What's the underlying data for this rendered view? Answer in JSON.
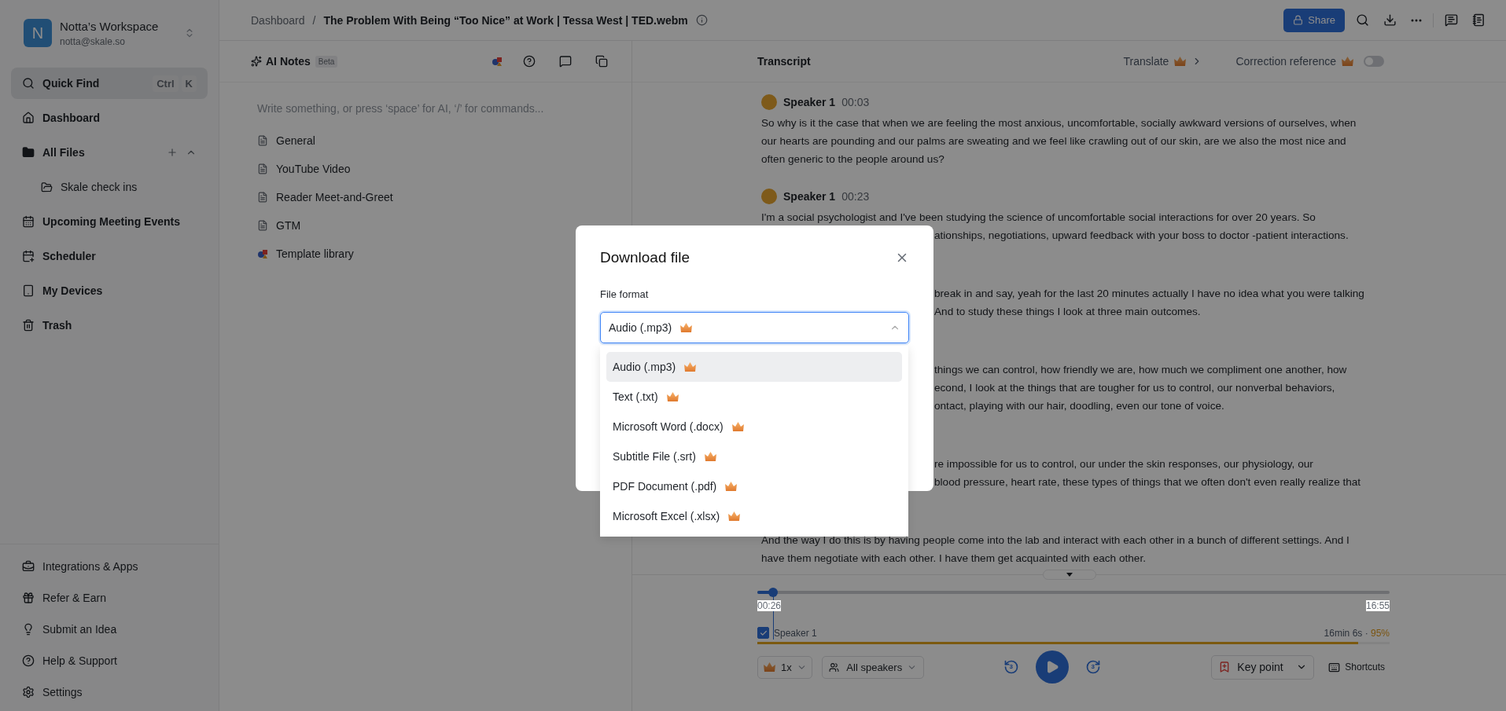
{
  "workspace": {
    "initial": "N",
    "name": "Notta’s Workspace",
    "email": "notta@skale.so"
  },
  "sidebar": {
    "quick_find": {
      "label": "Quick Find",
      "keys": [
        "Ctrl",
        "K"
      ],
      "selected": true
    },
    "items": [
      {
        "label": "Dashboard",
        "selected": false
      },
      {
        "label": "All Files",
        "selected": false,
        "expanded": true,
        "children": [
          {
            "label": "Skale check ins",
            "selected": false
          }
        ]
      },
      {
        "label": "Upcoming Meeting Events",
        "selected": false
      },
      {
        "label": "Scheduler",
        "selected": false
      },
      {
        "label": "My Devices",
        "selected": false
      },
      {
        "label": "Trash",
        "selected": false
      }
    ],
    "bottom_items": [
      {
        "label": "Integrations & Apps"
      },
      {
        "label": "Refer & Earn"
      },
      {
        "label": "Submit an Idea"
      },
      {
        "label": "Help & Support"
      },
      {
        "label": "Settings"
      }
    ]
  },
  "breadcrumb": {
    "parent": "Dashboard",
    "separator": "/",
    "title": "The Problem With Being “Too Nice” at Work | Tessa West | TED.webm"
  },
  "share_button": "Share",
  "notes": {
    "title": "AI Notes",
    "badge": "Beta",
    "placeholder": "Write something, or press ‘space’ for AI, ‘/’ for commands...",
    "templates": [
      {
        "label": "General",
        "kind": "doc"
      },
      {
        "label": "YouTube Video",
        "kind": "doc"
      },
      {
        "label": "Reader Meet-and-Greet",
        "kind": "doc"
      },
      {
        "label": "GTM",
        "kind": "doc"
      },
      {
        "label": "Template library",
        "kind": "library"
      }
    ]
  },
  "transcript": {
    "title": "Transcript",
    "translate": "Translate",
    "correction": {
      "label": "Correction reference",
      "on": false
    },
    "segments": [
      {
        "speaker": "Speaker 1",
        "time": "00:03",
        "lines": [
          {
            "kind": "full",
            "text": "So why is it the case that when we are feeling the most anxious, uncomfortable, socially awkward versions of ourselves, when"
          },
          {
            "kind": "full",
            "text": "our hearts are pounding and our palms are sweating and we feel like crawling out of our skin, are we also the most nice and"
          },
          {
            "kind": "full",
            "text": "often generic to the people around us?"
          }
        ]
      },
      {
        "speaker": "Speaker 1",
        "time": "00:23",
        "lines": [
          {
            "kind": "full",
            "text": "I'm a social psychologist and I've been studying the science of uncomfortable social interactions for over 20 years. So"
          },
          {
            "kind": "clipped",
            "text": "ationships, negotiations, upward feedback with your boss to doctor -patient interactions."
          }
        ]
      },
      {
        "lines": [
          {
            "kind": "clipped",
            "text": "break in and say, yeah for the last 20 minutes actually I have no idea what you were talking"
          },
          {
            "kind": "clipped",
            "text": "And to study these things I look at three main outcomes."
          }
        ]
      },
      {
        "lines": [
          {
            "kind": "clipped",
            "text": "things we can control, how friendly we are, how much we compliment one another, how"
          },
          {
            "kind": "clipped",
            "text": "econd, I look at the things that are tougher for us to control, our nonverbal behaviors,"
          },
          {
            "kind": "clipped",
            "text": "ontact, playing with our hair, doodling, even our tone of voice."
          }
        ]
      },
      {
        "lines": [
          {
            "kind": "clipped",
            "text": "re impossible for us to control, our under the skin responses, our physiology, our"
          },
          {
            "kind": "clipped",
            "text": "blood pressure, heart rate, these types of things that we often don't even really realize that"
          }
        ]
      },
      {
        "lines": [
          {
            "kind": "full",
            "text": "And the way I do this is by having people come into the lab and interact with each other in a bunch of different settings. And I"
          },
          {
            "kind": "full",
            "text": "have them negotiate with each other. I have them get acquainted with each other."
          }
        ]
      }
    ]
  },
  "player": {
    "level": 0.025,
    "current": "00:26",
    "total": "16:55",
    "speaker": {
      "label": "Speaker 1",
      "checked": true,
      "duration": "16min 6s · ",
      "share": "95%",
      "level": 0.95
    },
    "speed": "1x",
    "speakers": "All speakers",
    "skip_back": "3",
    "skip_forward": "3",
    "key_point": "Key point",
    "shortcuts": "Shortcuts"
  },
  "modal": {
    "title": "Download file",
    "field_label": "File format",
    "value": "Audio (.mp3)",
    "options": [
      {
        "label": "Audio (.mp3)",
        "selected": true
      },
      {
        "label": "Text (.txt)",
        "selected": false
      },
      {
        "label": "Microsoft Word (.docx)",
        "selected": false
      },
      {
        "label": "Subtitle File (.srt)",
        "selected": false
      },
      {
        "label": "PDF Document (.pdf)",
        "selected": false
      },
      {
        "label": "Microsoft Excel (.xlsx)",
        "selected": false
      }
    ]
  }
}
